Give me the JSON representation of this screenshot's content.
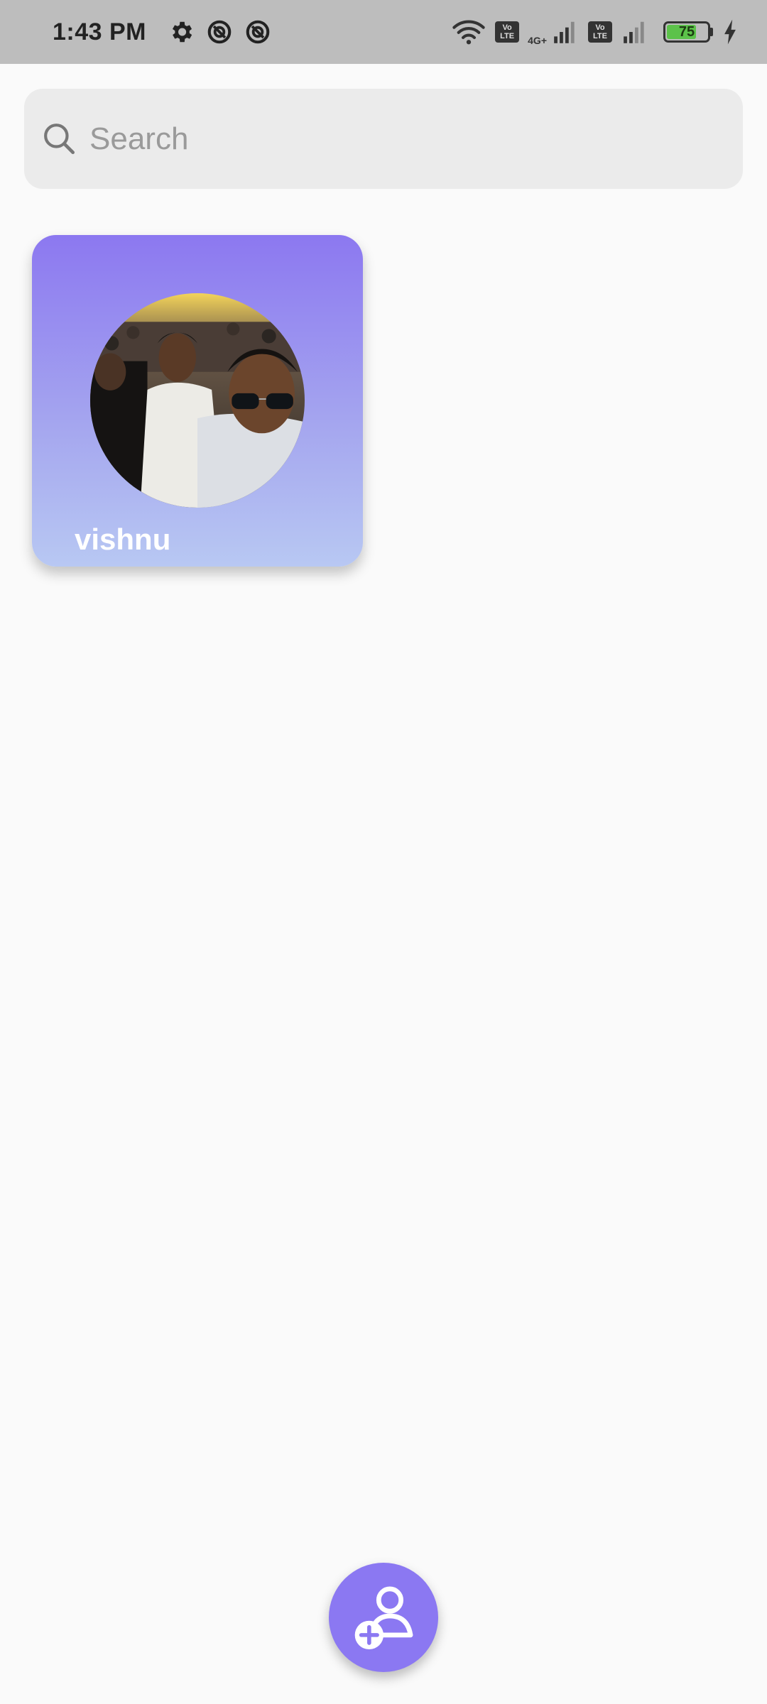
{
  "status_bar": {
    "time": "1:43 PM",
    "network_type": "4G+",
    "sim1_tag": "Vo LTE",
    "sim2_tag": "Vo LTE",
    "battery_level": "75",
    "battery_fraction": 0.75,
    "icons": [
      "gear-icon",
      "do-not-disturb-icon",
      "do-not-disturb-icon",
      "wifi-icon",
      "signal-icon",
      "signal-icon",
      "battery-icon",
      "charging-icon"
    ]
  },
  "search": {
    "placeholder": "Search",
    "value": ""
  },
  "contacts": [
    {
      "name": "vishnu",
      "avatar": "photo-of-three-people"
    }
  ],
  "fab": {
    "icon": "add-person-icon"
  },
  "colors": {
    "accent": "#8b78f2",
    "card_gradient_top": "#8c78f0",
    "card_gradient_bottom": "#b8c8f3",
    "background": "#fafafa",
    "search_background": "#ebebeb"
  }
}
